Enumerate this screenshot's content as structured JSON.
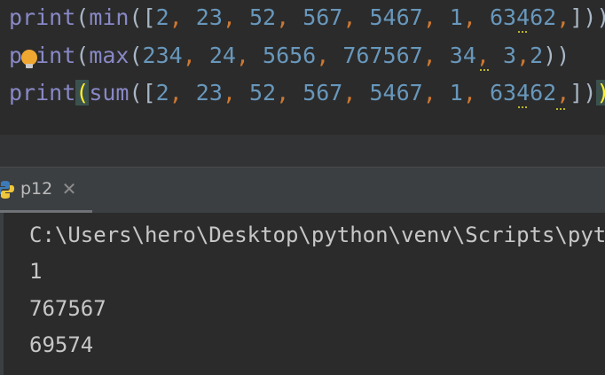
{
  "editor": {
    "lines": [
      {
        "tokens": [
          {
            "t": "print",
            "k": "fn"
          },
          {
            "t": "(",
            "k": "punc"
          },
          {
            "t": "min",
            "k": "fn"
          },
          {
            "t": "([",
            "k": "punc"
          },
          {
            "t": "2",
            "k": "num"
          },
          {
            "t": ", ",
            "k": "sep"
          },
          {
            "t": "23",
            "k": "num"
          },
          {
            "t": ", ",
            "k": "sep"
          },
          {
            "t": "52",
            "k": "num"
          },
          {
            "t": ", ",
            "k": "sep"
          },
          {
            "t": "567",
            "k": "num"
          },
          {
            "t": ", ",
            "k": "sep"
          },
          {
            "t": "5467",
            "k": "num"
          },
          {
            "t": ", ",
            "k": "sep"
          },
          {
            "t": "1",
            "k": "num"
          },
          {
            "t": ", ",
            "k": "sep"
          },
          {
            "t": "63462",
            "k": "num"
          },
          {
            "t": ",",
            "k": "sep"
          },
          {
            "t": "]))",
            "k": "punc"
          }
        ]
      },
      {
        "tokens": [
          {
            "t": "print",
            "k": "fn"
          },
          {
            "t": "(",
            "k": "punc"
          },
          {
            "t": "max",
            "k": "fn"
          },
          {
            "t": "(",
            "k": "punc"
          },
          {
            "t": "234",
            "k": "num"
          },
          {
            "t": ", ",
            "k": "sep"
          },
          {
            "t": "24",
            "k": "num"
          },
          {
            "t": ", ",
            "k": "sep"
          },
          {
            "t": "5656",
            "k": "num"
          },
          {
            "t": ", ",
            "k": "sep"
          },
          {
            "t": "767567",
            "k": "num"
          },
          {
            "t": ", ",
            "k": "sep"
          },
          {
            "t": "34",
            "k": "num"
          },
          {
            "t": ", ",
            "k": "sep"
          },
          {
            "t": "3",
            "k": "num"
          },
          {
            "t": ",",
            "k": "sep"
          },
          {
            "t": "2",
            "k": "num"
          },
          {
            "t": "))",
            "k": "punc"
          }
        ]
      },
      {
        "tokens": [
          {
            "t": "print",
            "k": "fn"
          },
          {
            "t": "(",
            "k": "paren-hl"
          },
          {
            "t": "sum",
            "k": "fn"
          },
          {
            "t": "([",
            "k": "punc"
          },
          {
            "t": "2",
            "k": "num"
          },
          {
            "t": ", ",
            "k": "sep"
          },
          {
            "t": "23",
            "k": "num"
          },
          {
            "t": ", ",
            "k": "sep"
          },
          {
            "t": "52",
            "k": "num"
          },
          {
            "t": ", ",
            "k": "sep"
          },
          {
            "t": "567",
            "k": "num"
          },
          {
            "t": ", ",
            "k": "sep"
          },
          {
            "t": "5467",
            "k": "num"
          },
          {
            "t": ", ",
            "k": "sep"
          },
          {
            "t": "1",
            "k": "num"
          },
          {
            "t": ", ",
            "k": "sep"
          },
          {
            "t": "63462",
            "k": "num"
          },
          {
            "t": ",",
            "k": "sep"
          },
          {
            "t": "])",
            "k": "punc"
          },
          {
            "t": ")",
            "k": "paren-hl"
          }
        ]
      }
    ],
    "intention_icon": "lightbulb-icon"
  },
  "run_panel": {
    "tab_label": "p12",
    "tab_icon": "python-icon",
    "close_icon": "close-icon"
  },
  "console": {
    "lines": [
      "C:\\Users\\hero\\Desktop\\python\\venv\\Scripts\\pytho",
      "1",
      "767567",
      "69574"
    ]
  },
  "colors": {
    "background": "#2b2b2b",
    "function": "#8888c6",
    "number": "#6897bb",
    "separator": "#cc7832",
    "paren_highlight": "#ffef28",
    "console_text": "#c7c7c7"
  }
}
